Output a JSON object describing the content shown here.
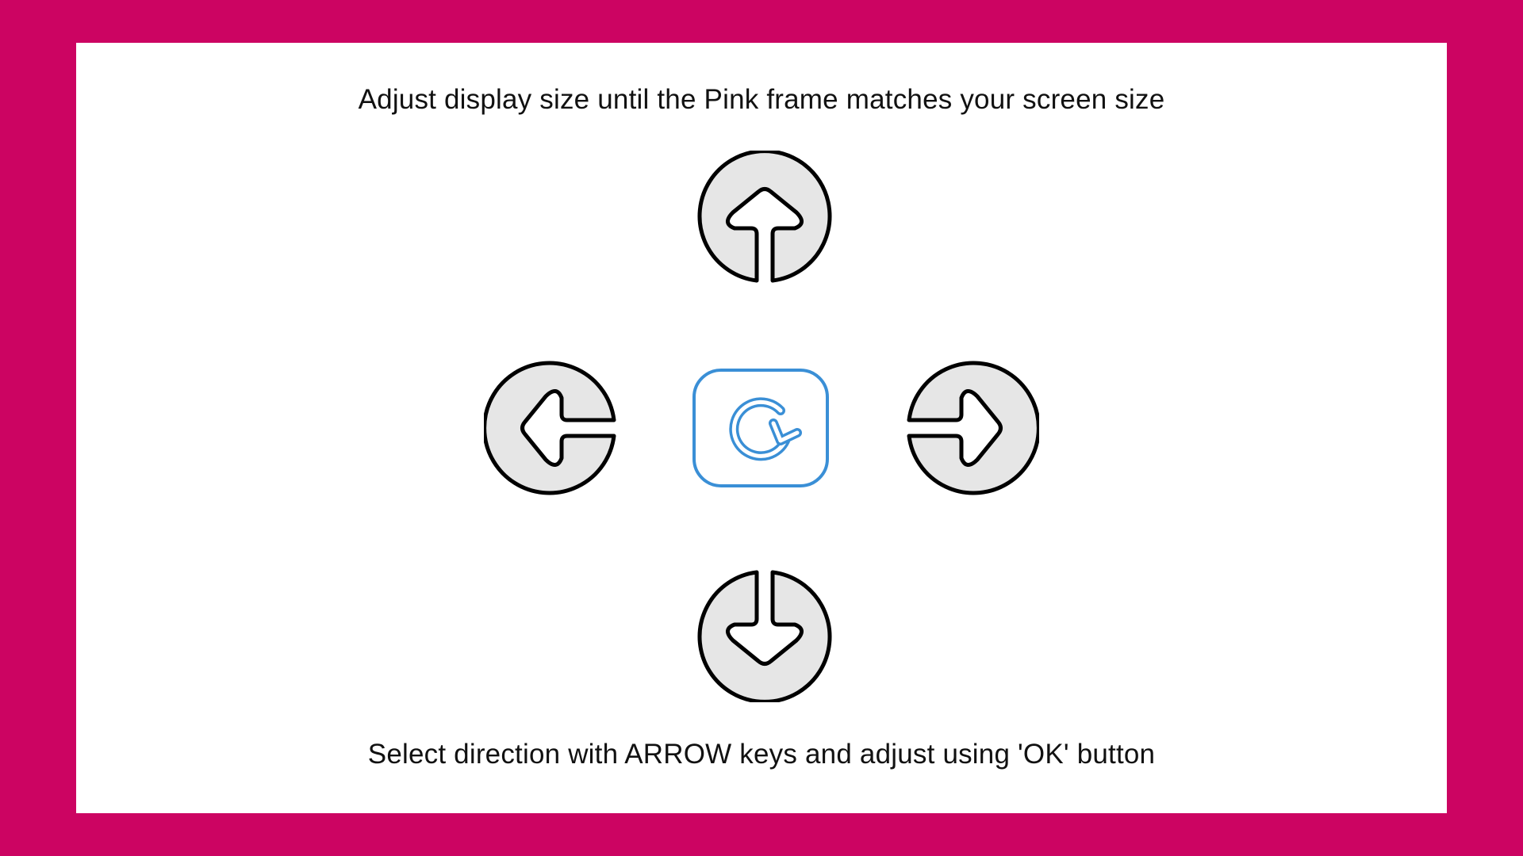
{
  "screen": {
    "title": "Adjust display size until the Pink frame matches your screen size",
    "hint": "Select direction with ARROW keys and adjust using 'OK' button"
  },
  "colors": {
    "frame": "#cc0462",
    "panel": "#ffffff",
    "arrow_fill": "#e6e6e6",
    "arrow_stroke": "#000000",
    "ok_accent": "#3a8fd6"
  },
  "controls": {
    "up": "arrow-up-icon",
    "down": "arrow-down-icon",
    "left": "arrow-left-icon",
    "right": "arrow-right-icon",
    "ok": "ok-refresh-icon"
  }
}
